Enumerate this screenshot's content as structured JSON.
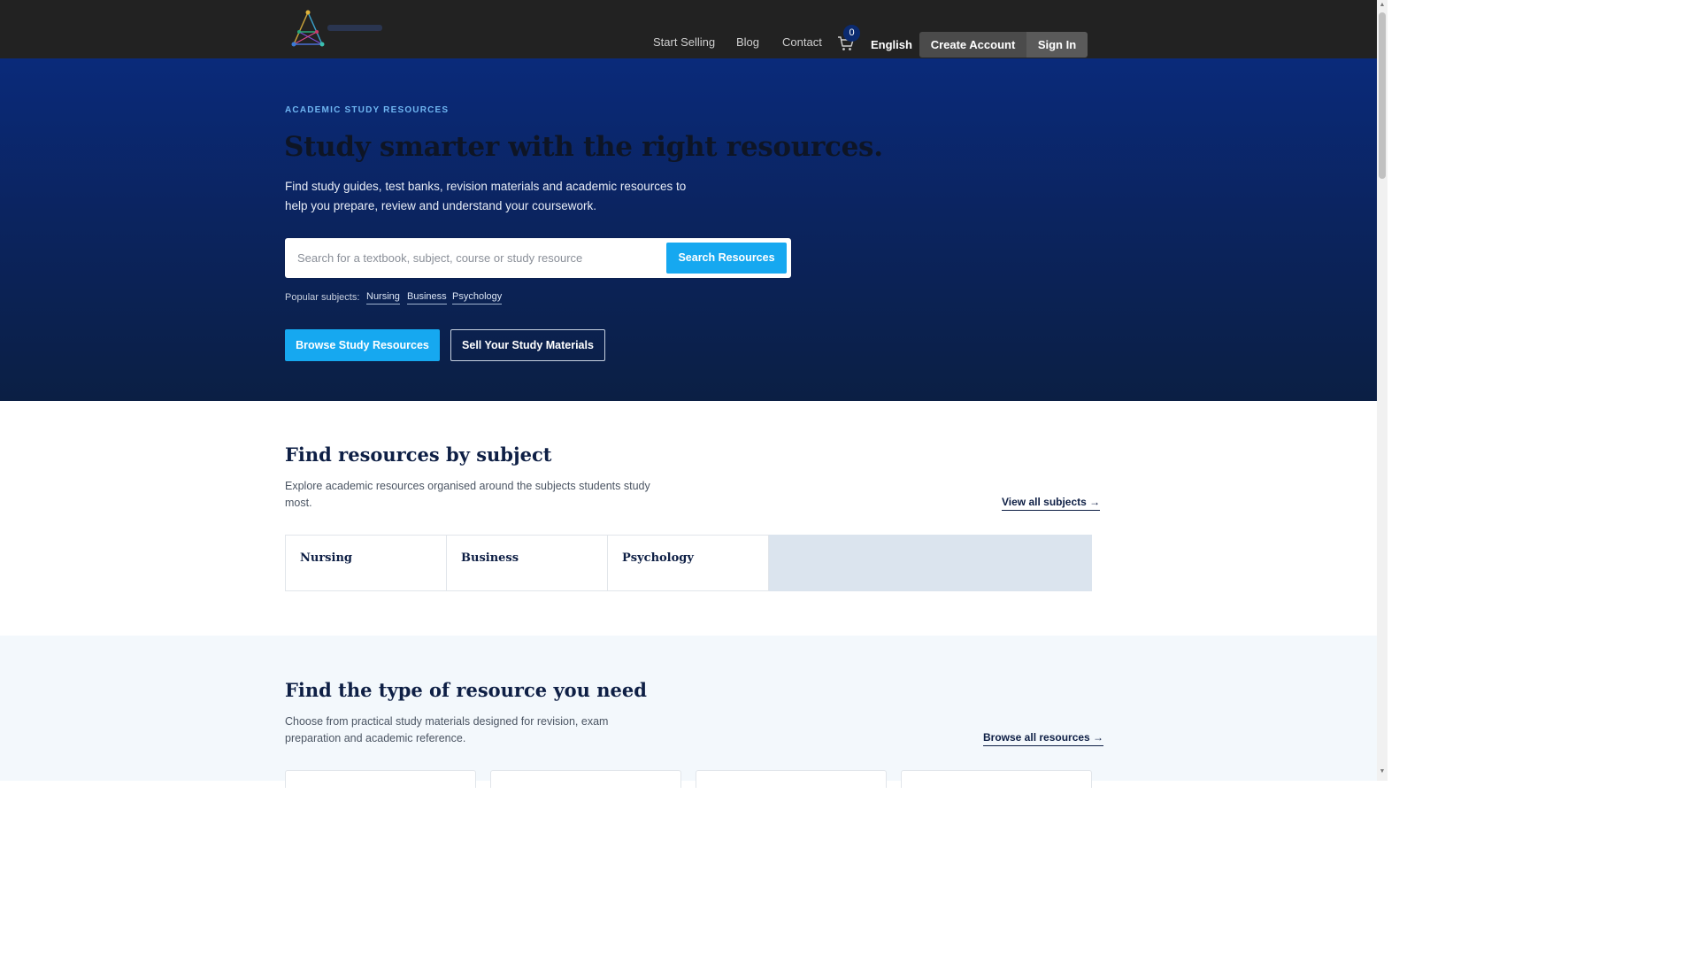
{
  "header": {
    "nav": [
      "Start Selling",
      "Blog",
      "Contact"
    ],
    "cart_count": "0",
    "language": "English",
    "create_account": "Create Account",
    "sign_in": "Sign In"
  },
  "hero": {
    "eyebrow": "ACADEMIC STUDY RESOURCES",
    "title": "Study smarter with the right resources.",
    "description": "Find study guides, test banks, revision materials and academic resources to help you prepare, review and understand your coursework.",
    "search_placeholder": "Search for a textbook, subject, course or study resource",
    "search_button": "Search Resources",
    "popular_label": "Popular subjects:",
    "popular_subjects": [
      "Nursing",
      "Business",
      "Psychology"
    ],
    "browse_button": "Browse Study Resources",
    "sell_button": "Sell Your Study Materials"
  },
  "subjects": {
    "title": "Find resources by subject",
    "description": "Explore academic resources organised around the subjects students study most.",
    "link": "View all subjects →",
    "cards": [
      "Nursing",
      "Business",
      "Psychology"
    ]
  },
  "resource_types": {
    "title": "Find the type of resource you need",
    "description": "Choose from practical study materials designed for revision, exam preparation and academic reference.",
    "link": "Browse all resources →"
  },
  "colors": {
    "header_bg": "#222222",
    "hero_top": "#0a2a7a",
    "hero_bottom": "#0b1f44",
    "accent": "#16a8f0",
    "heading": "#0e1f45"
  }
}
